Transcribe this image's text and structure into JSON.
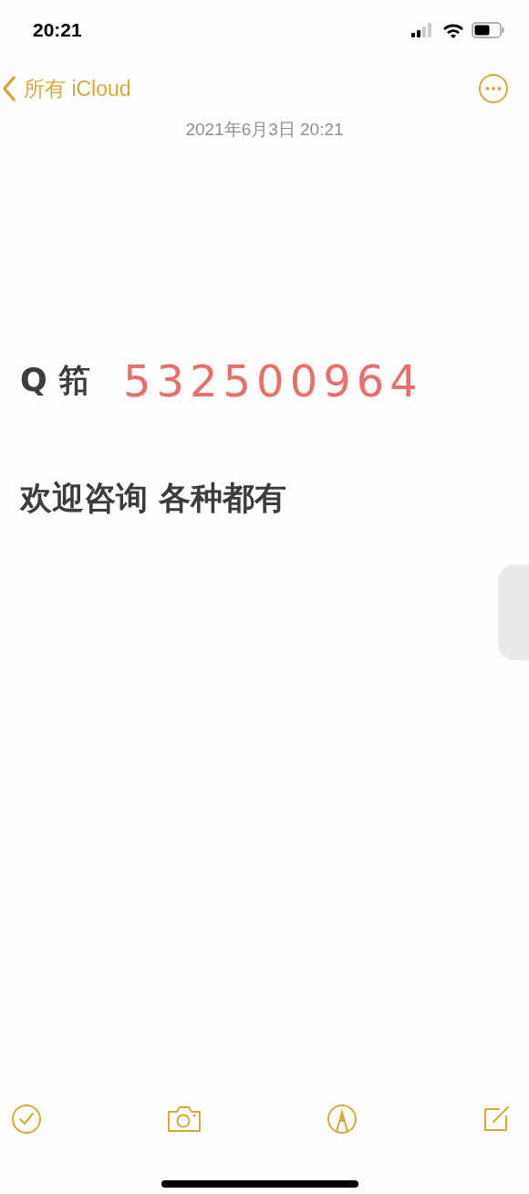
{
  "status_bar": {
    "time": "20:21"
  },
  "nav": {
    "back_label": "所有 iCloud"
  },
  "note": {
    "date": "2021年6月3日 20:21",
    "lines": [
      {
        "segments": [
          {
            "text": "Q 筘",
            "kind": "bold"
          },
          {
            "text": "532500964",
            "kind": "handwritten"
          }
        ]
      },
      {
        "segments": [
          {
            "text": "欢迎咨询 各种都有",
            "kind": "bold"
          }
        ]
      }
    ]
  }
}
